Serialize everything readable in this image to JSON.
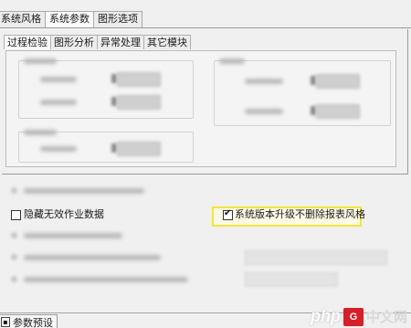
{
  "top_tabs": [
    {
      "label": "系统风格",
      "active": false
    },
    {
      "label": "系统参数",
      "active": true
    },
    {
      "label": "图形选项",
      "active": false
    }
  ],
  "sub_tabs": [
    {
      "label": "过程检验",
      "active": true
    },
    {
      "label": "图形分析",
      "active": false
    },
    {
      "label": "异常处理",
      "active": false
    },
    {
      "label": "其它模块",
      "active": false
    }
  ],
  "options": {
    "hide_invalid_jobs": {
      "label": "隐藏无效作业数据",
      "checked": false
    },
    "keep_report_style_on_upgrade": {
      "label": "系统版本升级不删除报表风格",
      "checked": true
    }
  },
  "bottom_tab": {
    "label": "参数预设",
    "icon": "settings-icon"
  },
  "watermark": {
    "php": "php",
    "site": "中文网",
    "mark": "G"
  },
  "colors": {
    "highlight": "#f2e73a",
    "watermark_red": "#d61f26"
  }
}
